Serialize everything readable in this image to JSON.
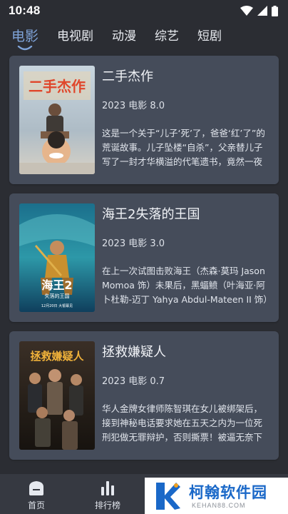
{
  "status_bar": {
    "time": "10:48"
  },
  "tabs": [
    {
      "label": "电影",
      "active": true
    },
    {
      "label": "电视剧",
      "active": false
    },
    {
      "label": "动漫",
      "active": false
    },
    {
      "label": "综艺",
      "active": false
    },
    {
      "label": "短剧",
      "active": false
    }
  ],
  "movies": [
    {
      "title": "二手杰作",
      "meta": "2023 电影 8.0",
      "description": "这是一个关于“儿子‘死’了，爸爸‘红’了”的荒诞故事。儿子坠楼“自杀”，父亲替儿子写了一封才华横溢的代笔遗书，竟然一夜成名……马寅波是位高中语文老师",
      "poster_text": "二手杰作"
    },
    {
      "title": "海王2失落的王国",
      "meta": "2023 电影 3.0",
      "description": "在上一次试图击败海王（杰森·莫玛 Jason Momoa 饰）未果后，黑蝠鲼（叶海亚·阿卜杜勒-迈丁 Yahya Abdul-Mateen II 饰）依然不甘放弃为父报仇",
      "poster_text": "海王2",
      "poster_subtext": "失落的王国",
      "poster_date": "12月20日 大银幕见"
    },
    {
      "title": "拯救嫌疑人",
      "meta": "2023 电影 0.7",
      "description": "华人金牌女律师陈智琪在女儿被绑架后，接到神秘电话要求她在五天之内为一位死刑犯做无罪辩护，否则撕票！被逼无奈下陈智琪联手警察金志展开调",
      "poster_text": "拯救嫌疑人"
    }
  ],
  "bottom_nav": [
    {
      "label": "首页",
      "icon": "home-icon"
    },
    {
      "label": "排行榜",
      "icon": "ranking-icon"
    }
  ],
  "watermark": {
    "title": "柯翰软件园",
    "domain": "KEHAN88.COM"
  },
  "colors": {
    "background": "#2b2d33",
    "card": "#454c5a",
    "accent": "#7fa3d8",
    "bottom_nav": "#363941",
    "watermark_blue": "#1a68c8"
  }
}
